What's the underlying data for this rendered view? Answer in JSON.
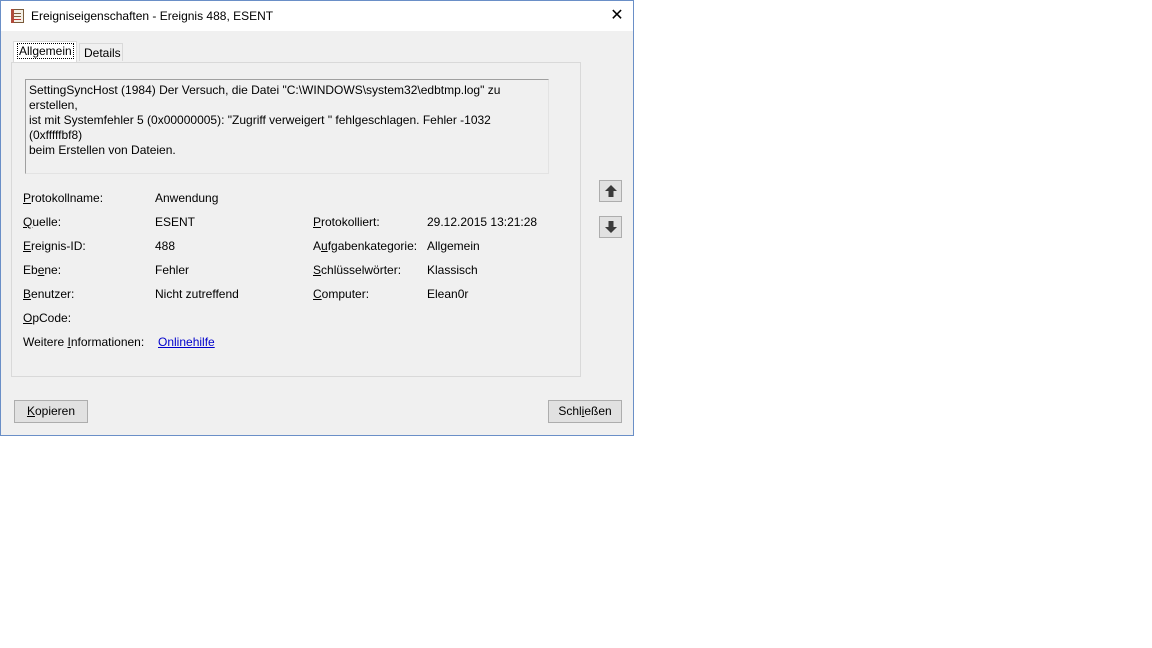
{
  "window": {
    "title": "Ereigniseigenschaften - Ereignis 488, ESENT",
    "close_glyph": "✕"
  },
  "tabs": [
    {
      "label": "Allgemein",
      "active": true
    },
    {
      "label": "Details",
      "active": false
    }
  ],
  "description": "SettingSyncHost (1984) Der Versuch, die Datei \"C:\\WINDOWS\\system32\\edbtmp.log\" zu erstellen,\nist mit Systemfehler 5 (0x00000005): \"Zugriff verweigert \" fehlgeschlagen. Fehler -1032 (0xfffffbf8)\nbeim Erstellen von Dateien.",
  "fields": {
    "protokollname": {
      "label_u": "P",
      "label_rest": "rotokollname:",
      "value": "Anwendung"
    },
    "quelle": {
      "label_u": "Q",
      "label_rest": "uelle:",
      "value": "ESENT"
    },
    "ereignis_id": {
      "label_u": "E",
      "label_rest": "reignis-ID:",
      "value": "488"
    },
    "ebene": {
      "label_pre": "Eb",
      "label_u": "e",
      "label_rest": "ne:",
      "value": "Fehler"
    },
    "benutzer": {
      "label_u": "B",
      "label_rest": "enutzer:",
      "value": "Nicht zutreffend"
    },
    "opcode": {
      "label_u": "O",
      "label_rest": "pCode:",
      "value": ""
    },
    "weitere": {
      "label_pre": "Weitere ",
      "label_u": "I",
      "label_rest": "nformationen:",
      "link": "Onlinehilfe"
    },
    "protokolliert": {
      "label_u": "P",
      "label_rest": "rotokolliert:",
      "value": "29.12.2015 13:21:28"
    },
    "aufgabenkategorie": {
      "label_pre": "A",
      "label_u": "u",
      "label_rest": "fgabenkategorie:",
      "value": "Allgemein"
    },
    "schluesselwoerter": {
      "label_u": "S",
      "label_rest": "chlüsselwörter:",
      "value": "Klassisch"
    },
    "computer": {
      "label_u": "C",
      "label_rest": "omputer:",
      "value": "Elean0r"
    }
  },
  "buttons": {
    "copy": {
      "label_u": "K",
      "label_rest": "opieren"
    },
    "close": {
      "label_pre": "Schl",
      "label_u": "i",
      "label_rest": "eßen"
    }
  },
  "icons": {
    "up": "arrow-up-icon",
    "down": "arrow-down-icon"
  }
}
